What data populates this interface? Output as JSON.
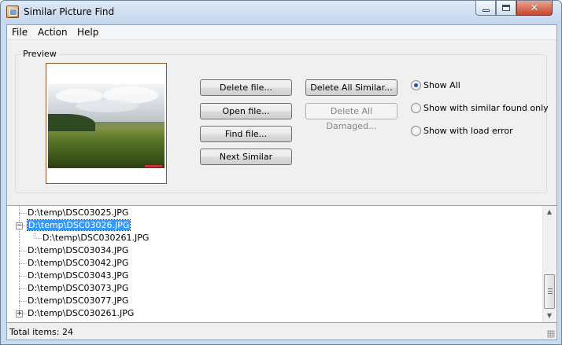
{
  "window": {
    "title": "Similar Picture Find"
  },
  "menu": [
    {
      "label": "File"
    },
    {
      "label": "Action"
    },
    {
      "label": "Help"
    }
  ],
  "preview": {
    "group_label": "Preview"
  },
  "buttons": {
    "delete_file": "Delete file...",
    "open_file": "Open file...",
    "find_file": "Find file...",
    "next_similar": "Next Similar",
    "delete_all_similar": "Delete All Similar...",
    "delete_all_damaged": "Delete All Damaged..."
  },
  "filter": {
    "options": [
      {
        "label": "Show All",
        "checked": true
      },
      {
        "label": "Show with similar found only",
        "checked": false
      },
      {
        "label": "Show with load error",
        "checked": false
      }
    ]
  },
  "tree": {
    "items": [
      {
        "label": "D:\\temp\\DSC03025.JPG",
        "level": 0
      },
      {
        "label": "D:\\temp\\DSC03026.JPG",
        "level": 0,
        "expanded": true,
        "selected": true
      },
      {
        "label": "D:\\temp\\DSC030261.JPG",
        "level": 1
      },
      {
        "label": "D:\\temp\\DSC03034.JPG",
        "level": 0
      },
      {
        "label": "D:\\temp\\DSC03042.JPG",
        "level": 0
      },
      {
        "label": "D:\\temp\\DSC03043.JPG",
        "level": 0
      },
      {
        "label": "D:\\temp\\DSC03073.JPG",
        "level": 0
      },
      {
        "label": "D:\\temp\\DSC03077.JPG",
        "level": 0
      },
      {
        "label": "D:\\temp\\DSC030261.JPG",
        "level": 0,
        "collapsed": true
      }
    ]
  },
  "status": {
    "text": "Total items: 24"
  }
}
